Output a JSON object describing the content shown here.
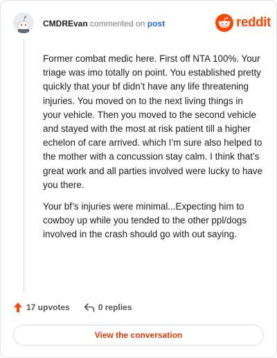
{
  "comment": {
    "author": "CMDREvan",
    "verb": "commented on",
    "link_text": "post",
    "paragraphs": [
      "Former combat medic here. First off NTA 100%. Your triage was imo totally on point. You established pretty quickly that your bf didn’t have any life threatening injuries. You moved on to the next living things in your vehicle. Then you moved to the second vehicle and stayed with the most at risk patient till a higher echelon of care arrived. which I’m sure also helped to the mother with a concussion stay calm. I think that’s great work and all parties involved were lucky to have you there.",
      "Your bf’s injuries were minimal...Expecting him to cowboy up while you tended to the other ppl/dogs involved in the crash should go with out saying."
    ]
  },
  "brand": {
    "wordmark": "reddit",
    "color": "#ff4500"
  },
  "actions": {
    "upvotes": "17 upvotes",
    "replies": "0 replies",
    "upvote_icon": "upvote-arrow-icon",
    "reply_icon": "reply-arrow-icon"
  },
  "cta": {
    "label": "View the conversation"
  }
}
